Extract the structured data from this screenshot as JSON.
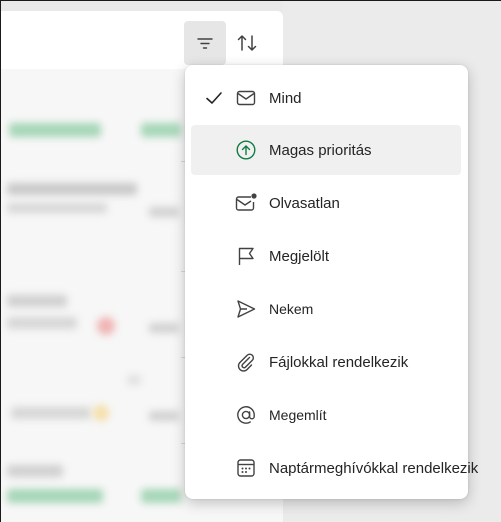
{
  "colors": {
    "accent_green": "#107c41",
    "text": "#242424",
    "icon": "#424242"
  },
  "toolbar": {
    "filter_icon": "filter-icon",
    "sort_icon": "sort-icon"
  },
  "filter_menu": {
    "selected": "Mind",
    "items": [
      {
        "label": "Mind",
        "icon": "mail-icon",
        "checked": true
      },
      {
        "label": "Magas prioritás",
        "icon": "arrow-up-circle-icon",
        "checked": false
      },
      {
        "label": "Olvasatlan",
        "icon": "mail-unread-icon",
        "checked": false
      },
      {
        "label": "Megjelölt",
        "icon": "flag-icon",
        "checked": false
      },
      {
        "label": "Nekem",
        "icon": "send-icon",
        "checked": false
      },
      {
        "label": "Fájlokkal rendelkezik",
        "icon": "attach-icon",
        "checked": false
      },
      {
        "label": "Megemlít",
        "icon": "mention-icon",
        "checked": false
      },
      {
        "label": "Naptármeghívókkal rendelkezik",
        "icon": "calendar-icon",
        "checked": false
      }
    ]
  }
}
